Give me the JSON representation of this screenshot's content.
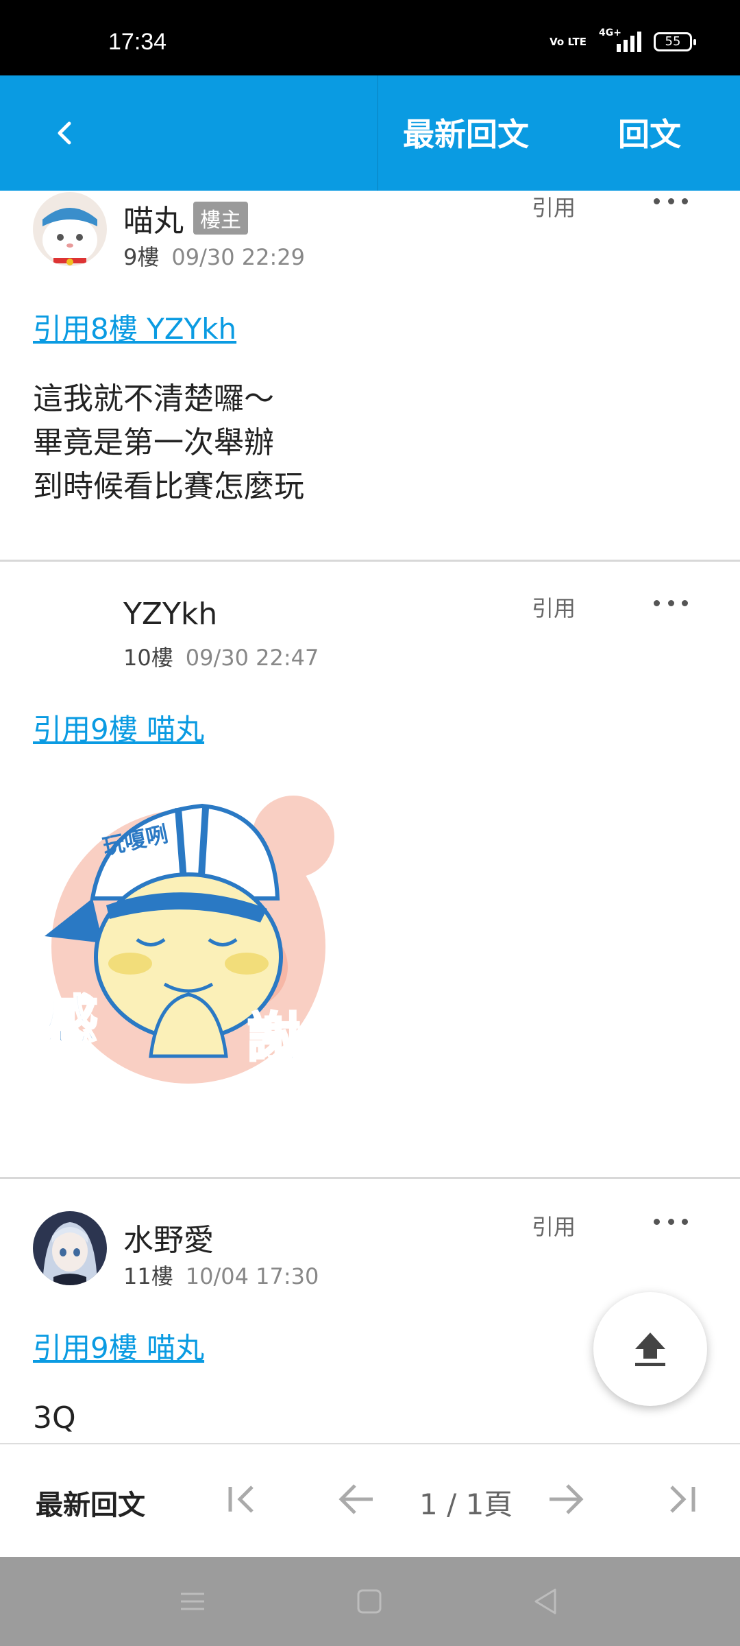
{
  "status_bar": {
    "time": "17:34",
    "volte": "Vo LTE",
    "network": "4G+",
    "battery": "55"
  },
  "app_bar": {
    "back_icon": "chevron-left-icon",
    "latest_label": "最新回文",
    "reply_label": "回文"
  },
  "posts": [
    {
      "author": "喵丸",
      "badge": "樓主",
      "floor": "9樓",
      "time": "09/30 22:29",
      "quote_action": "引用",
      "quote_link": "引用8樓 YZYkh",
      "lines": [
        "這我就不清楚囉～",
        "畢竟是第一次舉辦",
        "到時候看比賽怎麼玩"
      ]
    },
    {
      "author": "YZYkh",
      "floor": "10樓",
      "time": "09/30 22:47",
      "quote_action": "引用",
      "quote_link": "引用9樓 喵丸",
      "sticker": {
        "cap_text": "玩嗄咧",
        "left_char": "感",
        "right_char": "謝"
      }
    },
    {
      "author": "水野愛",
      "floor": "11樓",
      "time": "10/04 17:30",
      "quote_action": "引用",
      "quote_link": "引用9樓 喵丸",
      "lines": [
        "3Q"
      ]
    }
  ],
  "fab_icon": "upload-icon",
  "bottom_bar": {
    "latest_label": "最新回文",
    "page_indicator": "1 / 1頁",
    "icons": [
      "first-page-icon",
      "prev-arrow-icon",
      "next-arrow-icon",
      "last-page-icon"
    ]
  },
  "nav_bar": {
    "icons": [
      "menu-icon",
      "home-icon",
      "back-triangle-icon"
    ]
  },
  "colors": {
    "accent": "#0a9be2",
    "divider": "#d8d8d8",
    "nav_bar": "#9c9c9c"
  }
}
